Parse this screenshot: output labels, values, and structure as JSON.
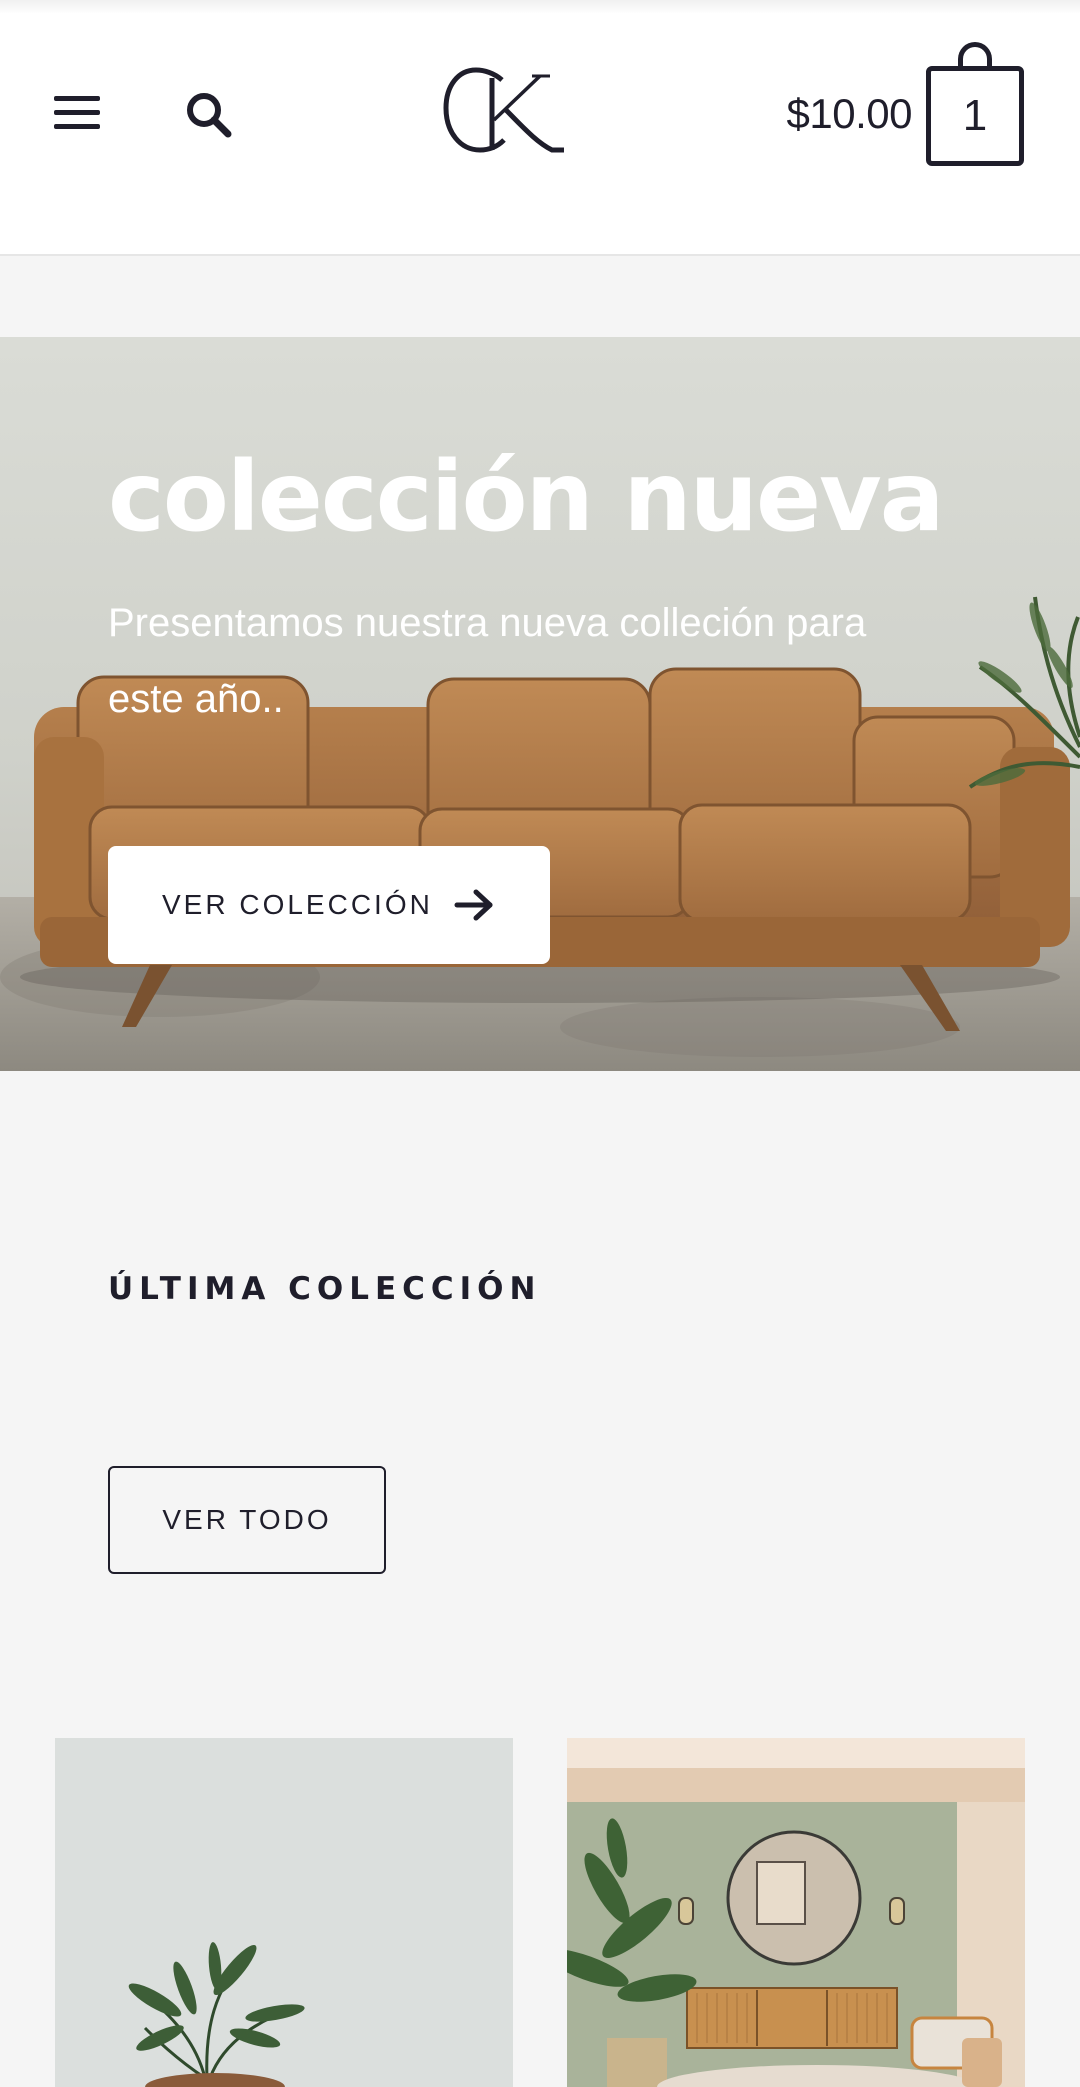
{
  "header": {
    "logo_text": "CK",
    "cart_total": "$10.00",
    "cart_count": "1",
    "icons": [
      "menu-icon",
      "search-icon",
      "shopping-bag-icon"
    ]
  },
  "hero": {
    "title": "colección nueva",
    "subtitle": "Presentamos nuestra nueva colleción para este año..",
    "button_label": "VER COLECCIÓN",
    "button_icon": "arrow-right-icon",
    "image": "leather-sofa-photo"
  },
  "latest": {
    "title": "ÚLTIMA COLECCIÓN",
    "see_all_label": "VER TODO",
    "products": [
      {
        "image": "potted-plant-photo"
      },
      {
        "image": "living-room-interior-photo"
      }
    ]
  },
  "colors": {
    "text_dark": "#1f1e2b",
    "background": "#f5f5f5",
    "header_bg": "#ffffff",
    "button_bg": "#ffffff"
  }
}
